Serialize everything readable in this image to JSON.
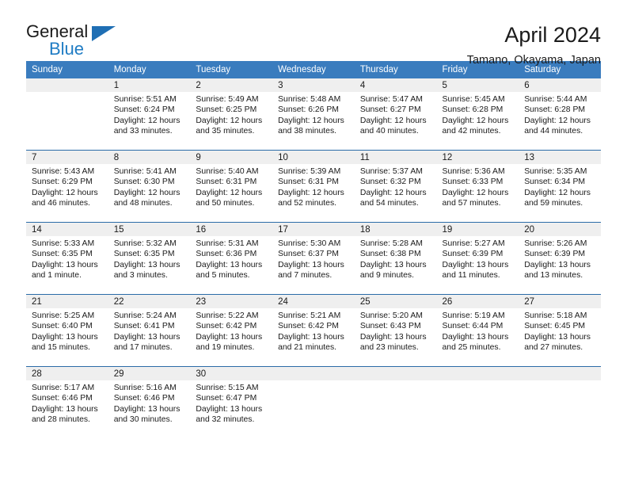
{
  "brand": {
    "name_part1": "General",
    "name_part2": "Blue",
    "accent_color": "#1f7cc4",
    "flag_icon": "triangle-flag-icon"
  },
  "header": {
    "title": "April 2024",
    "subtitle": "Tamano, Okayama, Japan"
  },
  "calendar": {
    "header_bg": "#3a7cbe",
    "row_rule_color": "#2b6ca8",
    "daynum_band_color": "#efefef",
    "weekdays": [
      "Sunday",
      "Monday",
      "Tuesday",
      "Wednesday",
      "Thursday",
      "Friday",
      "Saturday"
    ],
    "weeks": [
      [
        {
          "day": "",
          "sunrise": "",
          "sunset": "",
          "daylight_line1": "",
          "daylight_line2": ""
        },
        {
          "day": "1",
          "sunrise": "Sunrise: 5:51 AM",
          "sunset": "Sunset: 6:24 PM",
          "daylight_line1": "Daylight: 12 hours",
          "daylight_line2": "and 33 minutes."
        },
        {
          "day": "2",
          "sunrise": "Sunrise: 5:49 AM",
          "sunset": "Sunset: 6:25 PM",
          "daylight_line1": "Daylight: 12 hours",
          "daylight_line2": "and 35 minutes."
        },
        {
          "day": "3",
          "sunrise": "Sunrise: 5:48 AM",
          "sunset": "Sunset: 6:26 PM",
          "daylight_line1": "Daylight: 12 hours",
          "daylight_line2": "and 38 minutes."
        },
        {
          "day": "4",
          "sunrise": "Sunrise: 5:47 AM",
          "sunset": "Sunset: 6:27 PM",
          "daylight_line1": "Daylight: 12 hours",
          "daylight_line2": "and 40 minutes."
        },
        {
          "day": "5",
          "sunrise": "Sunrise: 5:45 AM",
          "sunset": "Sunset: 6:28 PM",
          "daylight_line1": "Daylight: 12 hours",
          "daylight_line2": "and 42 minutes."
        },
        {
          "day": "6",
          "sunrise": "Sunrise: 5:44 AM",
          "sunset": "Sunset: 6:28 PM",
          "daylight_line1": "Daylight: 12 hours",
          "daylight_line2": "and 44 minutes."
        }
      ],
      [
        {
          "day": "7",
          "sunrise": "Sunrise: 5:43 AM",
          "sunset": "Sunset: 6:29 PM",
          "daylight_line1": "Daylight: 12 hours",
          "daylight_line2": "and 46 minutes."
        },
        {
          "day": "8",
          "sunrise": "Sunrise: 5:41 AM",
          "sunset": "Sunset: 6:30 PM",
          "daylight_line1": "Daylight: 12 hours",
          "daylight_line2": "and 48 minutes."
        },
        {
          "day": "9",
          "sunrise": "Sunrise: 5:40 AM",
          "sunset": "Sunset: 6:31 PM",
          "daylight_line1": "Daylight: 12 hours",
          "daylight_line2": "and 50 minutes."
        },
        {
          "day": "10",
          "sunrise": "Sunrise: 5:39 AM",
          "sunset": "Sunset: 6:31 PM",
          "daylight_line1": "Daylight: 12 hours",
          "daylight_line2": "and 52 minutes."
        },
        {
          "day": "11",
          "sunrise": "Sunrise: 5:37 AM",
          "sunset": "Sunset: 6:32 PM",
          "daylight_line1": "Daylight: 12 hours",
          "daylight_line2": "and 54 minutes."
        },
        {
          "day": "12",
          "sunrise": "Sunrise: 5:36 AM",
          "sunset": "Sunset: 6:33 PM",
          "daylight_line1": "Daylight: 12 hours",
          "daylight_line2": "and 57 minutes."
        },
        {
          "day": "13",
          "sunrise": "Sunrise: 5:35 AM",
          "sunset": "Sunset: 6:34 PM",
          "daylight_line1": "Daylight: 12 hours",
          "daylight_line2": "and 59 minutes."
        }
      ],
      [
        {
          "day": "14",
          "sunrise": "Sunrise: 5:33 AM",
          "sunset": "Sunset: 6:35 PM",
          "daylight_line1": "Daylight: 13 hours",
          "daylight_line2": "and 1 minute."
        },
        {
          "day": "15",
          "sunrise": "Sunrise: 5:32 AM",
          "sunset": "Sunset: 6:35 PM",
          "daylight_line1": "Daylight: 13 hours",
          "daylight_line2": "and 3 minutes."
        },
        {
          "day": "16",
          "sunrise": "Sunrise: 5:31 AM",
          "sunset": "Sunset: 6:36 PM",
          "daylight_line1": "Daylight: 13 hours",
          "daylight_line2": "and 5 minutes."
        },
        {
          "day": "17",
          "sunrise": "Sunrise: 5:30 AM",
          "sunset": "Sunset: 6:37 PM",
          "daylight_line1": "Daylight: 13 hours",
          "daylight_line2": "and 7 minutes."
        },
        {
          "day": "18",
          "sunrise": "Sunrise: 5:28 AM",
          "sunset": "Sunset: 6:38 PM",
          "daylight_line1": "Daylight: 13 hours",
          "daylight_line2": "and 9 minutes."
        },
        {
          "day": "19",
          "sunrise": "Sunrise: 5:27 AM",
          "sunset": "Sunset: 6:39 PM",
          "daylight_line1": "Daylight: 13 hours",
          "daylight_line2": "and 11 minutes."
        },
        {
          "day": "20",
          "sunrise": "Sunrise: 5:26 AM",
          "sunset": "Sunset: 6:39 PM",
          "daylight_line1": "Daylight: 13 hours",
          "daylight_line2": "and 13 minutes."
        }
      ],
      [
        {
          "day": "21",
          "sunrise": "Sunrise: 5:25 AM",
          "sunset": "Sunset: 6:40 PM",
          "daylight_line1": "Daylight: 13 hours",
          "daylight_line2": "and 15 minutes."
        },
        {
          "day": "22",
          "sunrise": "Sunrise: 5:24 AM",
          "sunset": "Sunset: 6:41 PM",
          "daylight_line1": "Daylight: 13 hours",
          "daylight_line2": "and 17 minutes."
        },
        {
          "day": "23",
          "sunrise": "Sunrise: 5:22 AM",
          "sunset": "Sunset: 6:42 PM",
          "daylight_line1": "Daylight: 13 hours",
          "daylight_line2": "and 19 minutes."
        },
        {
          "day": "24",
          "sunrise": "Sunrise: 5:21 AM",
          "sunset": "Sunset: 6:42 PM",
          "daylight_line1": "Daylight: 13 hours",
          "daylight_line2": "and 21 minutes."
        },
        {
          "day": "25",
          "sunrise": "Sunrise: 5:20 AM",
          "sunset": "Sunset: 6:43 PM",
          "daylight_line1": "Daylight: 13 hours",
          "daylight_line2": "and 23 minutes."
        },
        {
          "day": "26",
          "sunrise": "Sunrise: 5:19 AM",
          "sunset": "Sunset: 6:44 PM",
          "daylight_line1": "Daylight: 13 hours",
          "daylight_line2": "and 25 minutes."
        },
        {
          "day": "27",
          "sunrise": "Sunrise: 5:18 AM",
          "sunset": "Sunset: 6:45 PM",
          "daylight_line1": "Daylight: 13 hours",
          "daylight_line2": "and 27 minutes."
        }
      ],
      [
        {
          "day": "28",
          "sunrise": "Sunrise: 5:17 AM",
          "sunset": "Sunset: 6:46 PM",
          "daylight_line1": "Daylight: 13 hours",
          "daylight_line2": "and 28 minutes."
        },
        {
          "day": "29",
          "sunrise": "Sunrise: 5:16 AM",
          "sunset": "Sunset: 6:46 PM",
          "daylight_line1": "Daylight: 13 hours",
          "daylight_line2": "and 30 minutes."
        },
        {
          "day": "30",
          "sunrise": "Sunrise: 5:15 AM",
          "sunset": "Sunset: 6:47 PM",
          "daylight_line1": "Daylight: 13 hours",
          "daylight_line2": "and 32 minutes."
        },
        {
          "day": "",
          "sunrise": "",
          "sunset": "",
          "daylight_line1": "",
          "daylight_line2": ""
        },
        {
          "day": "",
          "sunrise": "",
          "sunset": "",
          "daylight_line1": "",
          "daylight_line2": ""
        },
        {
          "day": "",
          "sunrise": "",
          "sunset": "",
          "daylight_line1": "",
          "daylight_line2": ""
        },
        {
          "day": "",
          "sunrise": "",
          "sunset": "",
          "daylight_line1": "",
          "daylight_line2": ""
        }
      ]
    ]
  }
}
